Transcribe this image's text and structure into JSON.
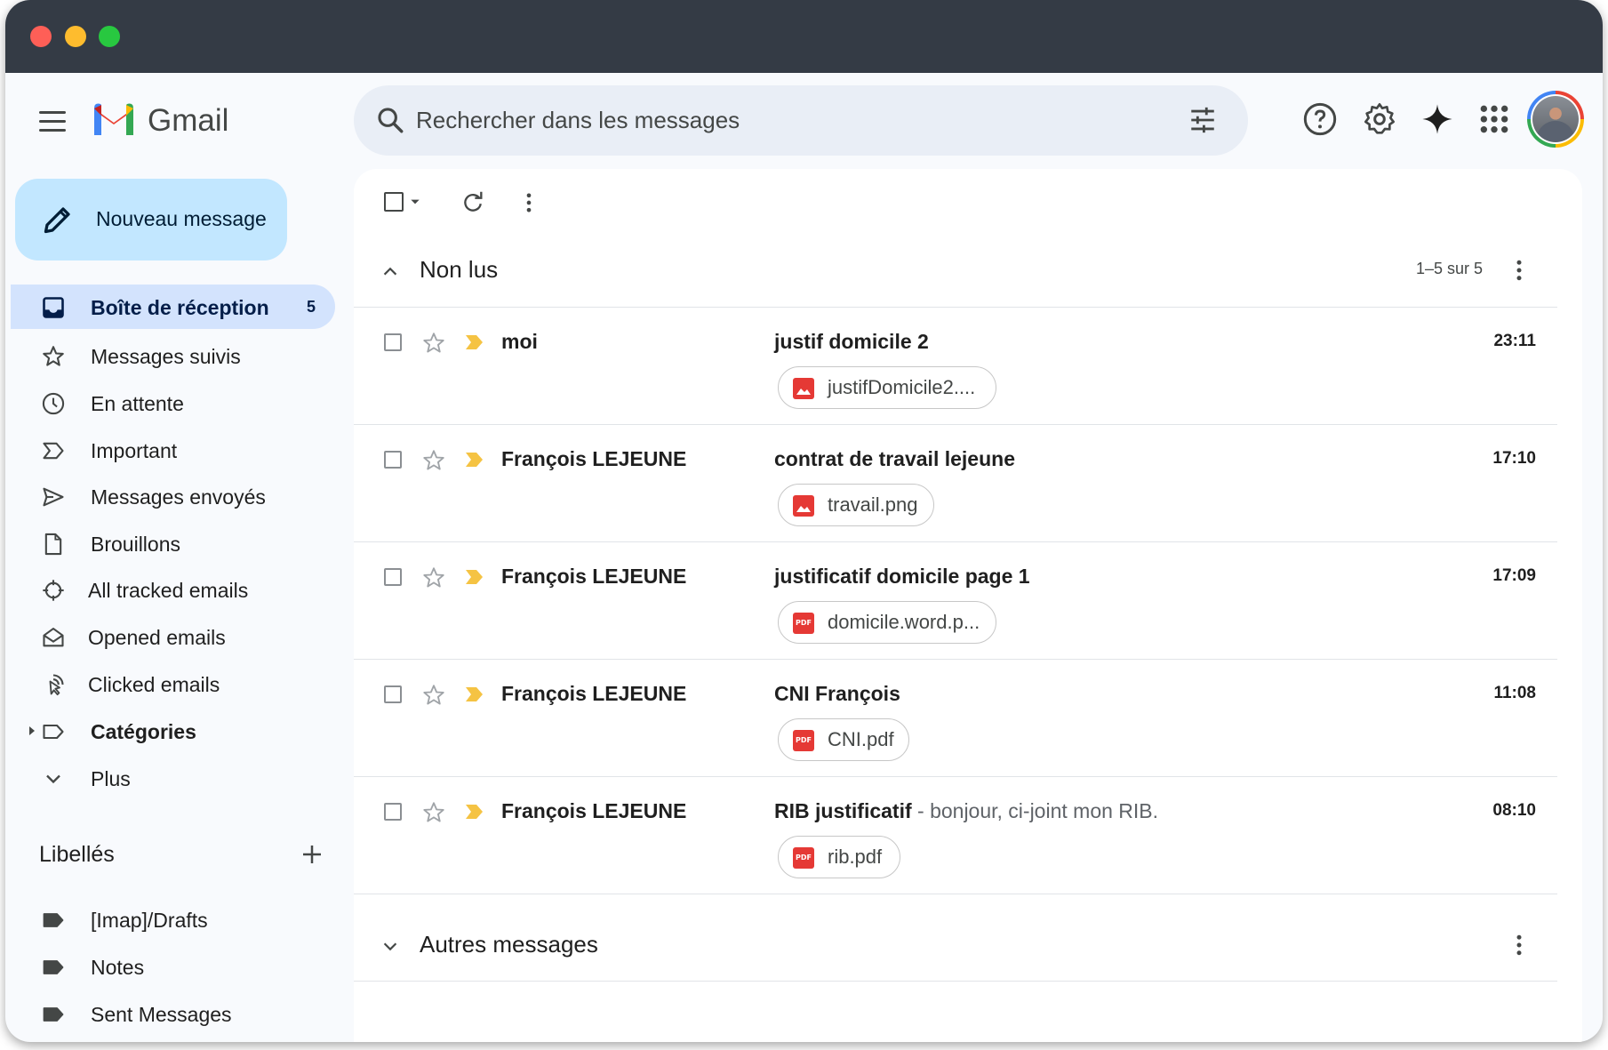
{
  "app": {
    "name": "Gmail"
  },
  "search": {
    "placeholder": "Rechercher dans les messages"
  },
  "compose": {
    "label": "Nouveau message"
  },
  "sidebar": {
    "items": [
      {
        "label": "Boîte de réception",
        "count": "5",
        "icon": "inbox-icon"
      },
      {
        "label": "Messages suivis",
        "icon": "star-icon"
      },
      {
        "label": "En attente",
        "icon": "clock-icon"
      },
      {
        "label": "Important",
        "icon": "important-icon"
      },
      {
        "label": "Messages envoyés",
        "icon": "send-icon"
      },
      {
        "label": "Brouillons",
        "icon": "draft-icon"
      },
      {
        "label": "All tracked emails",
        "icon": "crosshair-icon"
      },
      {
        "label": "Opened emails",
        "icon": "envelope-open-icon"
      },
      {
        "label": "Clicked emails",
        "icon": "click-icon"
      },
      {
        "label": "Catégories",
        "icon": "label-icon"
      },
      {
        "label": "Plus",
        "icon": "chevron-down-icon"
      }
    ],
    "labels_title": "Libellés",
    "labels": [
      {
        "label": "[Imap]/Drafts"
      },
      {
        "label": "Notes"
      },
      {
        "label": "Sent Messages"
      }
    ]
  },
  "sections": {
    "unread": {
      "title": "Non lus",
      "range": "1–5 sur 5"
    },
    "others": {
      "title": "Autres messages"
    }
  },
  "emails": [
    {
      "sender": "moi",
      "subject": "justif domicile 2",
      "snippet": "",
      "time": "23:11",
      "attachment": "justifDomicile2....",
      "type": "image"
    },
    {
      "sender": "François LEJEUNE",
      "subject": "contrat de travail lejeune",
      "snippet": "",
      "time": "17:10",
      "attachment": "travail.png",
      "type": "image"
    },
    {
      "sender": "François LEJEUNE",
      "subject": "justificatif domicile page 1",
      "snippet": "",
      "time": "17:09",
      "attachment": "domicile.word.p...",
      "type": "pdf"
    },
    {
      "sender": "François LEJEUNE",
      "subject": "CNI François",
      "snippet": "",
      "time": "11:08",
      "attachment": "CNI.pdf",
      "type": "pdf"
    },
    {
      "sender": "François LEJEUNE",
      "subject": "RIB justificatif",
      "snippet": " - bonjour, ci-joint mon RIB.",
      "time": "08:10",
      "attachment": "rib.pdf",
      "type": "pdf"
    }
  ],
  "file_badges": {
    "pdf": "PDF"
  },
  "colors": {
    "compose_bg": "#c2e7ff",
    "active_nav": "#d3e3fd",
    "search_bg": "#e9eef6",
    "important": "#f5c343",
    "attachment_red": "#e53935"
  }
}
